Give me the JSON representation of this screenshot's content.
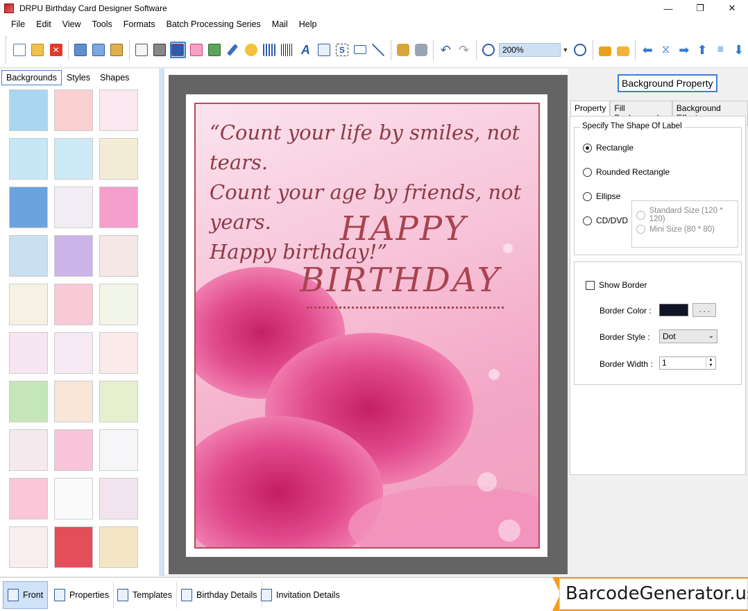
{
  "window": {
    "title": "DRPU Birthday Card Designer Software",
    "controls": [
      "—",
      "❐",
      "✕"
    ]
  },
  "menu": [
    "File",
    "Edit",
    "View",
    "Tools",
    "Formats",
    "Batch Processing Series",
    "Mail",
    "Help"
  ],
  "toolbar": {
    "zoom_value": "200%",
    "icons": [
      "new-icon",
      "open-icon",
      "close-file-icon",
      "save-icon",
      "save-as-icon",
      "export-icon",
      "print-preview-icon",
      "print-icon",
      "view-card-icon",
      "gift-icon",
      "image-icon",
      "pen-icon",
      "shape-icon",
      "barcode-icon",
      "barcode2-icon",
      "text-icon",
      "wordart-icon",
      "signature-icon",
      "mail-icon",
      "line-icon",
      "db-icon",
      "db2-icon",
      "undo-icon",
      "redo-icon",
      "zoom-in-icon",
      "zoom-out-icon",
      "lock-icon",
      "unlock-icon",
      "back-icon",
      "flip-icon",
      "forward-icon",
      "up-icon",
      "align-icon",
      "down-icon"
    ]
  },
  "left_panel": {
    "tabs": [
      "Backgrounds",
      "Styles",
      "Shapes"
    ],
    "active_tab": "Backgrounds",
    "thumbnails": [
      {
        "color": "#a9d6f0",
        "name": "clouds"
      },
      {
        "color": "#f9cfd0",
        "name": "pink-texture"
      },
      {
        "color": "#fbe8f0",
        "name": "butterflies"
      },
      {
        "color": "#c6e7f5",
        "name": "flowers"
      },
      {
        "color": "#cde9f5",
        "name": "bears"
      },
      {
        "color": "#f5ecd8",
        "name": "balloons-bird"
      },
      {
        "color": "#6aa3de",
        "name": "stars"
      },
      {
        "color": "#f3eef5",
        "name": "balloons"
      },
      {
        "color": "#f59fcc",
        "name": "gifts"
      },
      {
        "color": "#c9dff2",
        "name": "bubbles"
      },
      {
        "color": "#cbb5e8",
        "name": "rainbow"
      },
      {
        "color": "#f5e8e6",
        "name": "faded-flowers"
      },
      {
        "color": "#f6f1e4",
        "name": "happy-birthday"
      },
      {
        "color": "#f9c9d6",
        "name": "pink-curtain"
      },
      {
        "color": "#f2f6e8",
        "name": "balloon-pattern"
      },
      {
        "color": "#f6e6f2",
        "name": "hearts"
      },
      {
        "color": "#f7e9f3",
        "name": "balloon-bunches"
      },
      {
        "color": "#fbeaea",
        "name": "red-hearts"
      },
      {
        "color": "#c5e7b8",
        "name": "green-stripes"
      },
      {
        "color": "#f8e5d6",
        "name": "cakes"
      },
      {
        "color": "#e6f0cf",
        "name": "party"
      },
      {
        "color": "#f5e9ed",
        "name": "roses"
      },
      {
        "color": "#f7c4d9",
        "name": "pink-hearts"
      },
      {
        "color": "#f6f6f8",
        "name": "party-hats"
      },
      {
        "color": "#f9c7d8",
        "name": "pink-diamonds"
      },
      {
        "color": "#fafafa",
        "name": "confetti"
      },
      {
        "color": "#f2e4ee",
        "name": "purple-flowers"
      },
      {
        "color": "#f8eef0",
        "name": "cake-pattern"
      },
      {
        "color": "#e44d5a",
        "name": "heart-pile"
      },
      {
        "color": "#f4e6c5",
        "name": "birthday-balloons"
      }
    ]
  },
  "card": {
    "quote_line1": "“Count your life by smiles, not tears.",
    "quote_line2": "Count your age by friends, not years.",
    "quote_line3": "Happy birthday!”",
    "happy": "HAPPY",
    "birthday": "BIRTHDAY",
    "border_color": "#b44c5c",
    "text_color": "#a8434f"
  },
  "right_panel": {
    "title": "Background Property",
    "tabs": [
      "Property",
      "Fill Background",
      "Background Effects"
    ],
    "active_tab": "Property",
    "shape_group_label": "Specify The Shape Of Label",
    "shapes": [
      "Rectangle",
      "Rounded Rectangle",
      "Ellipse",
      "CD/DVD"
    ],
    "selected_shape": "Rectangle",
    "cd_sizes": [
      "Standard Size (120 * 120)",
      "Mini Size (80 * 80)"
    ],
    "show_border_label": "Show Border",
    "show_border_checked": false,
    "border_color_label": "Border Color :",
    "border_color_value": "#111427",
    "border_color_button": ". . .",
    "border_style_label": "Border Style :",
    "border_style_value": "Dot",
    "border_width_label": "Border Width :",
    "border_width_value": "1"
  },
  "bottom_tabs": [
    "Front",
    "Properties",
    "Templates",
    "Birthday Details",
    "Invitation Details"
  ],
  "active_bottom_tab": "Front",
  "watermark": "BarcodeGenerator.us"
}
